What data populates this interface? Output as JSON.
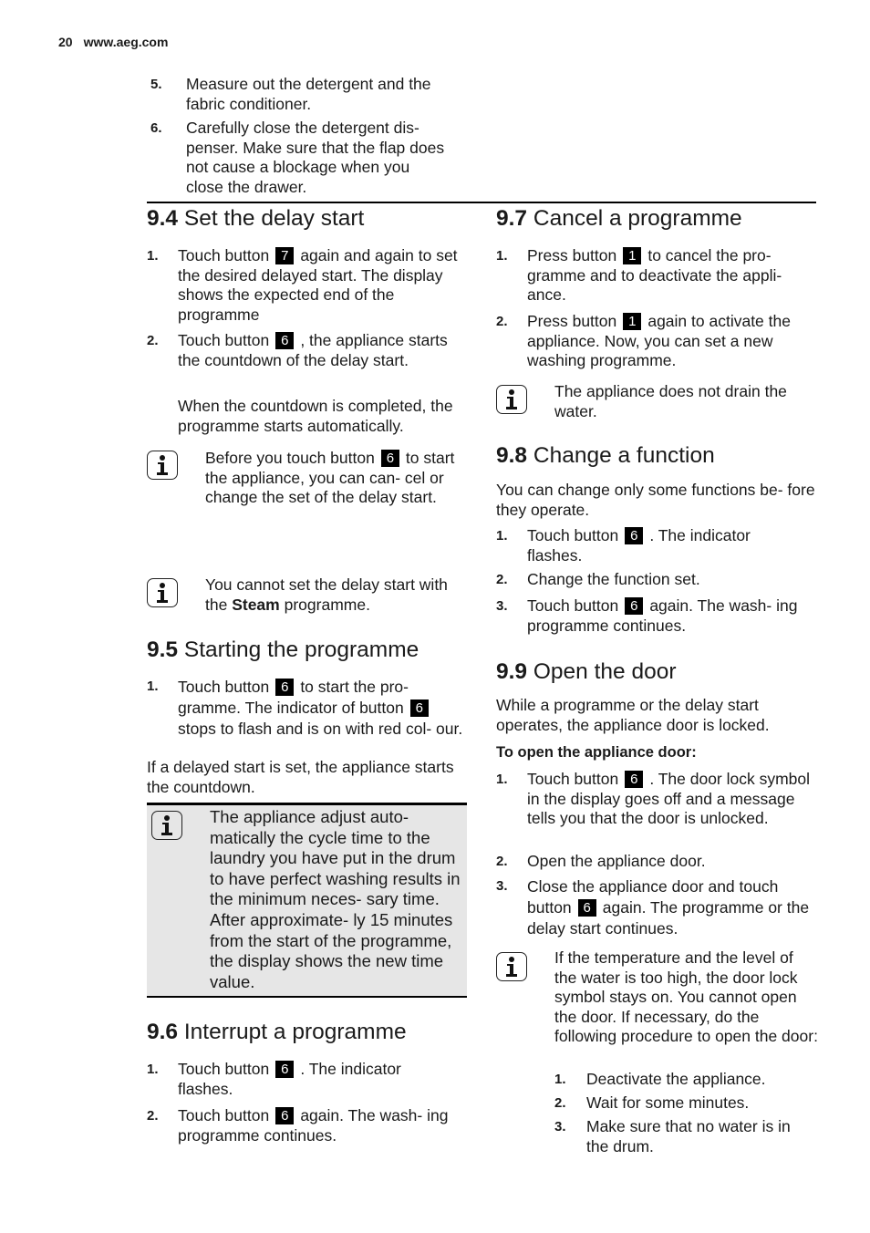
{
  "header": {
    "page_number": "20",
    "site": "www.aeg.com"
  },
  "intro_steps": [
    {
      "num": "5.",
      "text": "Measure out the detergent and the fabric conditioner."
    },
    {
      "num": "6.",
      "text": "Carefully close the detergent dis- penser. Make sure that the flap does not cause a blockage when you close the drawer."
    }
  ],
  "s94": {
    "num": "9.4",
    "title": "Set the delay start",
    "step1": {
      "num": "1.",
      "pre": "Touch button",
      "key": "7",
      "post": "again and again to set the desired delayed start. The display shows the expected end of the programme"
    },
    "step2": {
      "num": "2.",
      "pre": "Touch button",
      "key": "6",
      "post": ", the appliance starts the countdown of the delay start."
    },
    "after": "When the countdown is completed, the programme starts automatically.",
    "note1": {
      "pre": "Before you touch button",
      "key": "6",
      "post": "to start the appliance, you can can- cel or change the set of the delay start."
    },
    "note2": {
      "pre": "You cannot set the delay start with the",
      "bold": "Steam",
      "post": "programme."
    }
  },
  "s95": {
    "num": "9.5",
    "title": "Starting the programme",
    "step1": {
      "num": "1.",
      "pre": "Touch button",
      "key": "6",
      "mid": "to start the pro- gramme. The indicator of button",
      "key2": "6",
      "post": "stops to flash and is on with red col- our."
    },
    "after": "If a delayed start is set, the appliance starts the countdown.",
    "note": "The appliance adjust auto- matically the cycle time to the laundry you have put in the drum to have perfect washing results in the minimum neces- sary time. After approximate- ly 15 minutes from the start of the programme, the display shows the new time value."
  },
  "s96": {
    "num": "9.6",
    "title": "Interrupt a programme",
    "step1": {
      "num": "1.",
      "pre": "Touch button",
      "key": "6",
      "post": ". The indicator flashes."
    },
    "step2": {
      "num": "2.",
      "pre": "Touch button",
      "key": "6",
      "post": "again. The wash- ing programme continues."
    }
  },
  "s97": {
    "num": "9.7",
    "title": "Cancel a programme",
    "step1": {
      "num": "1.",
      "pre": "Press button",
      "key": "1",
      "post": "to cancel the pro- gramme and to deactivate the appli- ance."
    },
    "step2": {
      "num": "2.",
      "pre": "Press button",
      "key": "1",
      "post": "again to activate the appliance. Now, you can set a new washing programme."
    },
    "note": "The appliance does not drain the water."
  },
  "s98": {
    "num": "9.8",
    "title": "Change a function",
    "intro": "You can change only some functions be- fore they operate.",
    "step1": {
      "num": "1.",
      "pre": "Touch button",
      "key": "6",
      "post": ". The indicator flashes."
    },
    "step2": {
      "num": "2.",
      "text": "Change the function set."
    },
    "step3": {
      "num": "3.",
      "pre": "Touch button",
      "key": "6",
      "post": "again. The wash- ing programme continues."
    }
  },
  "s99": {
    "num": "9.9",
    "title": "Open the door",
    "intro": "While a programme or the delay start operates, the appliance door is locked.",
    "subhead": "To open the appliance door:",
    "step1": {
      "num": "1.",
      "pre": "Touch button",
      "key": "6",
      "post": ". The door lock symbol in the display goes off and a message tells you that the door is unlocked."
    },
    "step2": {
      "num": "2.",
      "text": "Open the appliance door."
    },
    "step3": {
      "num": "3.",
      "pre": "Close the appliance door and touch button",
      "key": "6",
      "post": "again. The programme or the delay start continues."
    },
    "note": "If the temperature and the level of the water is too high, the door lock symbol stays on. You cannot open the door. If necessary, do the following procedure to open the door:",
    "substeps": [
      {
        "num": "1.",
        "text": "Deactivate the appliance."
      },
      {
        "num": "2.",
        "text": "Wait for some minutes."
      },
      {
        "num": "3.",
        "text": "Make sure that no water is in the drum."
      }
    ]
  }
}
